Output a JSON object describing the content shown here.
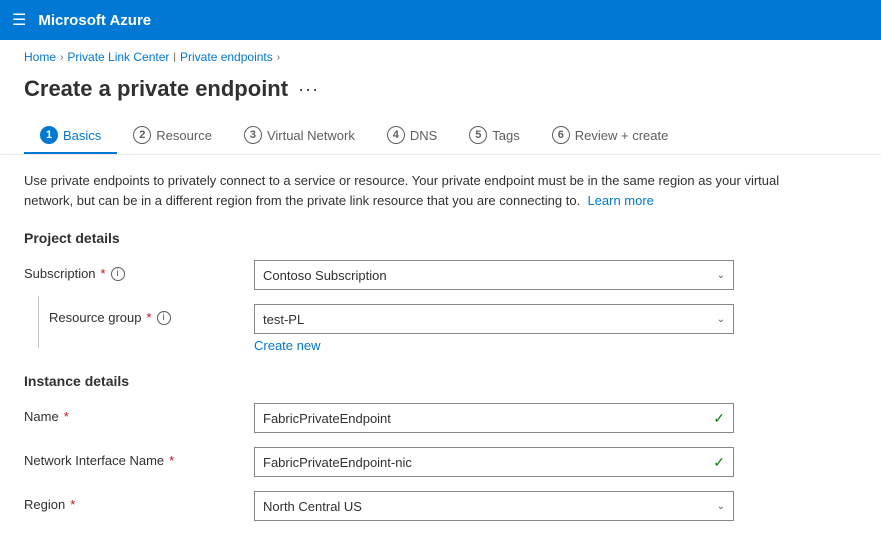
{
  "nav": {
    "title": "Microsoft Azure",
    "hamburger_icon": "☰"
  },
  "breadcrumb": {
    "items": [
      "Home",
      "Private Link Center",
      "Private endpoints"
    ],
    "separators": [
      ">",
      ">",
      ">"
    ]
  },
  "page": {
    "title": "Create a private endpoint",
    "ellipsis": "···"
  },
  "tabs": [
    {
      "num": "1",
      "label": "Basics",
      "active": true
    },
    {
      "num": "2",
      "label": "Resource",
      "active": false
    },
    {
      "num": "3",
      "label": "Virtual Network",
      "active": false
    },
    {
      "num": "4",
      "label": "DNS",
      "active": false
    },
    {
      "num": "5",
      "label": "Tags",
      "active": false
    },
    {
      "num": "6",
      "label": "Review + create",
      "active": false
    }
  ],
  "info_text": "Use private endpoints to privately connect to a service or resource. Your private endpoint must be in the same region as your virtual network, but can be in a different region from the private link resource that you are connecting to.",
  "info_link": "Learn more",
  "sections": {
    "project_details": {
      "heading": "Project details",
      "subscription": {
        "label": "Subscription",
        "required": true,
        "value": "Contoso Subscription",
        "info": "i"
      },
      "resource_group": {
        "label": "Resource group",
        "required": true,
        "value": "test-PL",
        "info": "i",
        "create_new": "Create new"
      }
    },
    "instance_details": {
      "heading": "Instance details",
      "name": {
        "label": "Name",
        "required": true,
        "value": "FabricPrivateEndpoint"
      },
      "network_interface_name": {
        "label": "Network Interface Name",
        "required": true,
        "value": "FabricPrivateEndpoint-nic"
      },
      "region": {
        "label": "Region",
        "required": true,
        "value": "North Central US"
      }
    }
  }
}
